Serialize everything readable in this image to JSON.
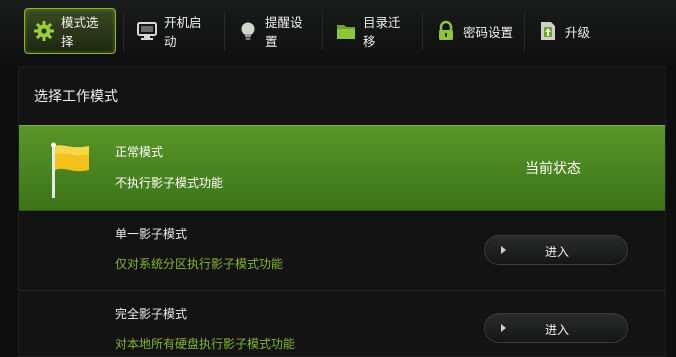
{
  "window": {
    "controls": [
      {
        "icon": "settings-icon",
        "glyph": "⚙"
      },
      {
        "icon": "close-icon",
        "glyph": "✕"
      }
    ]
  },
  "toolbar": {
    "tabs": [
      {
        "label": "模式选择",
        "icon": "gear-icon",
        "active": true
      },
      {
        "label": "开机启动",
        "icon": "monitor-icon",
        "active": false
      },
      {
        "label": "提醒设置",
        "icon": "bulb-icon",
        "active": false
      },
      {
        "label": "目录迁移",
        "icon": "folder-icon",
        "active": false
      },
      {
        "label": "密码设置",
        "icon": "lock-icon",
        "active": false
      },
      {
        "label": "升级",
        "icon": "upgrade-icon",
        "active": false
      }
    ]
  },
  "panel": {
    "title": "选择工作模式",
    "modes": [
      {
        "name": "正常模式",
        "description": "不执行影子模式功能",
        "status": "当前状态"
      },
      {
        "name": "单一影子模式",
        "description": "仅对系统分区执行影子模式功能",
        "button": "进入"
      },
      {
        "name": "完全影子模式",
        "description": "对本地所有硬盘执行影子模式功能",
        "button": "进入"
      }
    ]
  },
  "colors": {
    "accent_green": "#86b52e",
    "current_row_green": "#4c8a22",
    "background": "#0d0e0d"
  }
}
